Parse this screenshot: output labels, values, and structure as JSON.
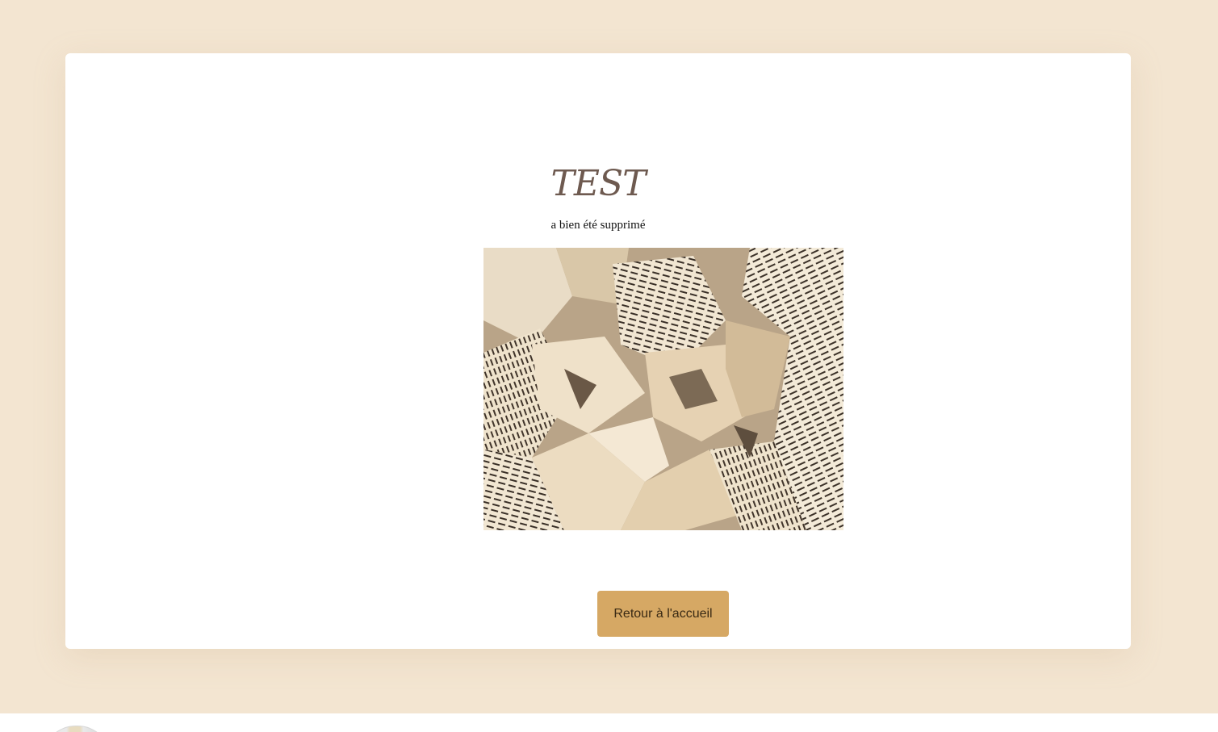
{
  "card": {
    "title": "TEST",
    "message": "a bien été supprimé",
    "image_alt": "Crumpled newspaper pages",
    "button_label": "Retour à l'accueil"
  },
  "colors": {
    "page_background": "#f3e5d1",
    "card_background": "#ffffff",
    "title": "#6e5a50",
    "button_background": "#d6a864",
    "button_text": "#3a2a14"
  },
  "footer": {
    "logo_icon": "site-logo-icon"
  }
}
